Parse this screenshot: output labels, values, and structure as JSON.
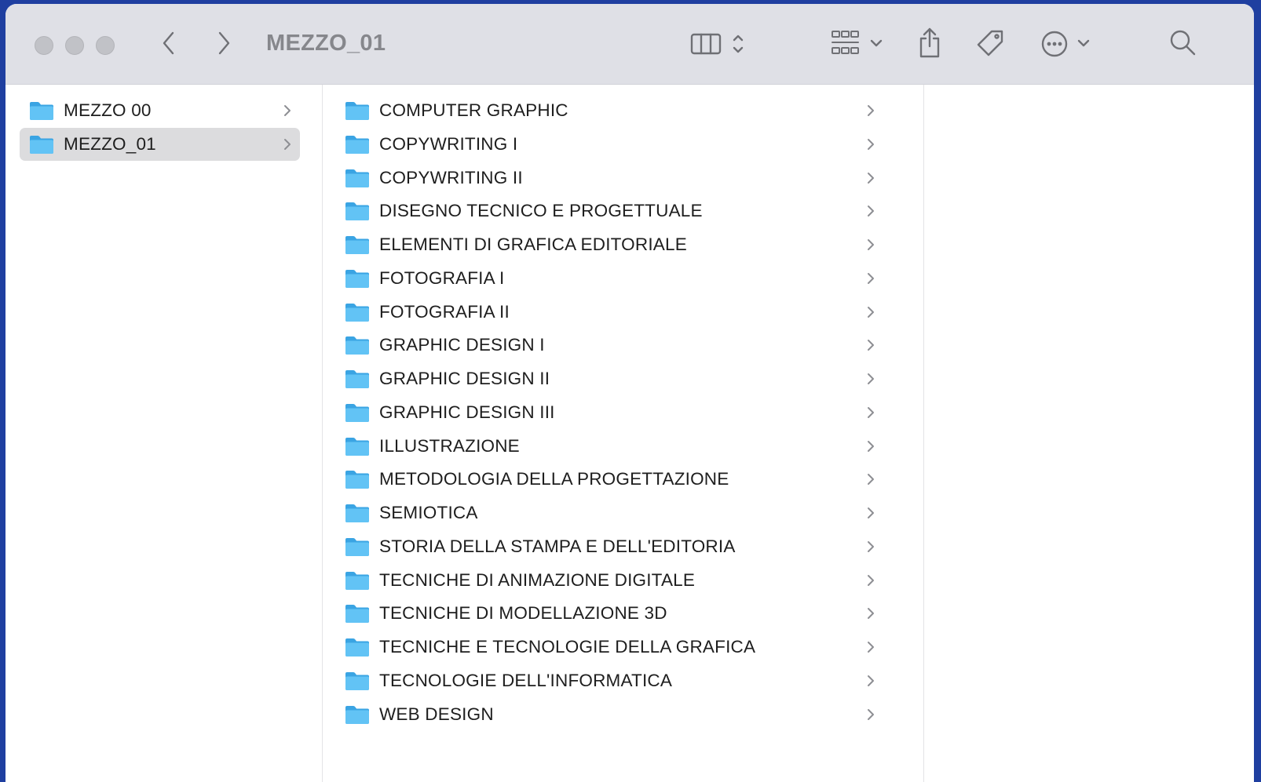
{
  "window": {
    "title": "MEZZO_01"
  },
  "toolbar": {
    "icons": [
      "back-icon",
      "forward-icon",
      "column-view-icon",
      "view-toggle-chevron-icon",
      "group-grid-icon",
      "chevron-down-icon",
      "share-icon",
      "tag-icon",
      "more-actions-icon",
      "chevron-down-icon",
      "search-icon"
    ]
  },
  "sidebar_column": {
    "items": [
      {
        "label": "MEZZO 00",
        "selected": false
      },
      {
        "label": "MEZZO_01",
        "selected": true
      }
    ]
  },
  "content_column": {
    "items": [
      {
        "label": "COMPUTER GRAPHIC"
      },
      {
        "label": "COPYWRITING I"
      },
      {
        "label": "COPYWRITING II"
      },
      {
        "label": "DISEGNO TECNICO E PROGETTUALE"
      },
      {
        "label": "ELEMENTI DI GRAFICA EDITORIALE"
      },
      {
        "label": "FOTOGRAFIA I"
      },
      {
        "label": "FOTOGRAFIA II"
      },
      {
        "label": "GRAPHIC DESIGN I"
      },
      {
        "label": "GRAPHIC DESIGN II"
      },
      {
        "label": "GRAPHIC DESIGN III"
      },
      {
        "label": "ILLUSTRAZIONE"
      },
      {
        "label": "METODOLOGIA DELLA PROGETTAZIONE"
      },
      {
        "label": "SEMIOTICA"
      },
      {
        "label": "STORIA DELLA STAMPA E DELL'EDITORIA"
      },
      {
        "label": "TECNICHE DI ANIMAZIONE DIGITALE"
      },
      {
        "label": "TECNICHE DI MODELLAZIONE 3D"
      },
      {
        "label": "TECNICHE E TECNOLOGIE DELLA GRAFICA"
      },
      {
        "label": "TECNOLOGIE DELL'INFORMATICA"
      },
      {
        "label": "WEB DESIGN"
      }
    ]
  },
  "colors": {
    "desktop": "#1f3fa0",
    "toolbar": "#dfe0e6",
    "folder": "#52b7f0",
    "selection": "#dcdcde"
  }
}
